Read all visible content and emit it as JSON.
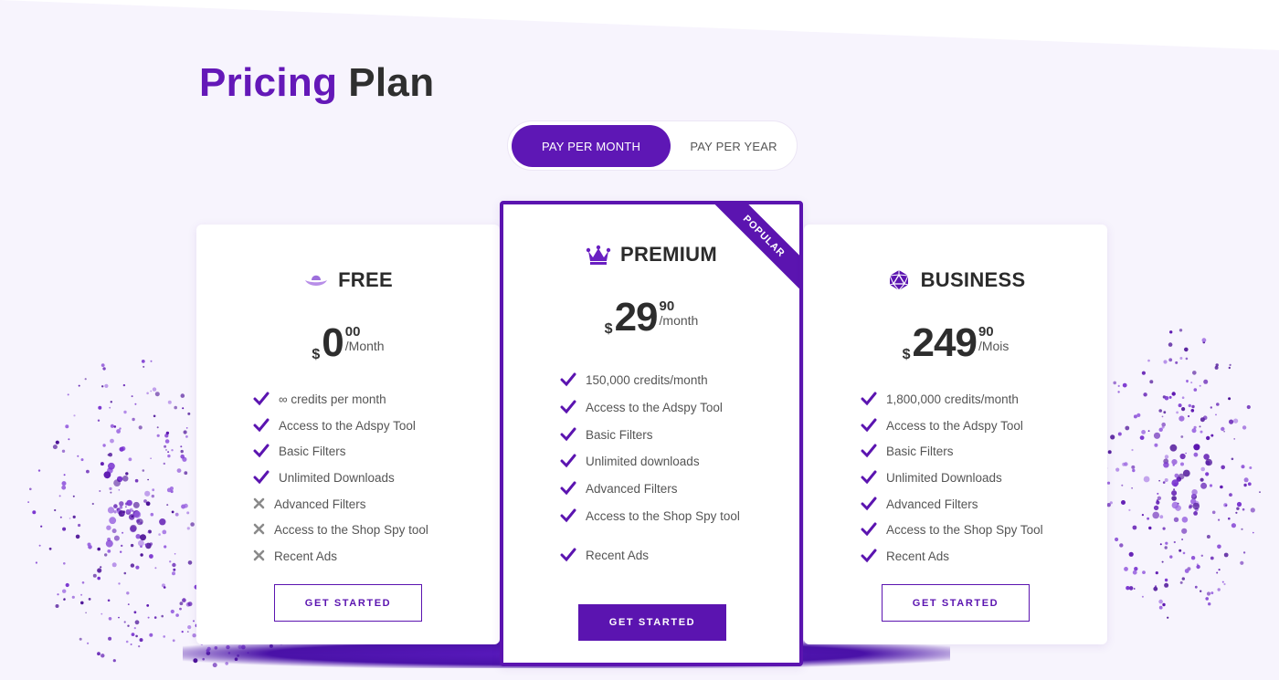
{
  "title": {
    "accent": "Pricing",
    "rest": "Plan"
  },
  "billing_toggle": {
    "monthly": "PAY PER MONTH",
    "yearly": "PAY PER YEAR",
    "selected": "monthly"
  },
  "colors": {
    "accent": "#5b14b0",
    "title_accent": "#6418b8",
    "check": "#5b14b0",
    "cross": "#8a8a8a"
  },
  "plans": [
    {
      "name": "FREE",
      "icon": "hat-icon",
      "currency": "$",
      "amount": "0",
      "cents": "00",
      "period": "/Month",
      "features": [
        {
          "label": "∞ credits per month",
          "included": true
        },
        {
          "label": "Access to the Adspy Tool",
          "included": true
        },
        {
          "label": "Basic Filters",
          "included": true
        },
        {
          "label": "Unlimited Downloads",
          "included": true
        },
        {
          "label": "Advanced Filters",
          "included": false
        },
        {
          "label": "Access to the Shop Spy tool",
          "included": false
        },
        {
          "label": "Recent Ads",
          "included": false
        }
      ],
      "cta": "GET STARTED"
    },
    {
      "name": "PREMIUM",
      "icon": "crown-icon",
      "badge": "POPULAR",
      "currency": "$",
      "amount": "29",
      "cents": "90",
      "period": "/month",
      "features": [
        {
          "label": "150,000 credits/month",
          "included": true
        },
        {
          "label": "Access to the Adspy Tool",
          "included": true
        },
        {
          "label": "Basic Filters",
          "included": true
        },
        {
          "label": "Unlimited downloads",
          "included": true
        },
        {
          "label": "Advanced Filters",
          "included": true
        },
        {
          "label": "Access to the Shop Spy tool",
          "included": true
        },
        {
          "label": "Recent Ads",
          "included": true
        }
      ],
      "cta": "GET STARTED"
    },
    {
      "name": "BUSINESS",
      "icon": "d20-dice-icon",
      "currency": "$",
      "amount": "249",
      "cents": "90",
      "period": "/Mois",
      "features": [
        {
          "label": "1,800,000 credits/month",
          "included": true
        },
        {
          "label": "Access to the Adspy Tool",
          "included": true
        },
        {
          "label": "Basic Filters",
          "included": true
        },
        {
          "label": "Unlimited Downloads",
          "included": true
        },
        {
          "label": "Advanced Filters",
          "included": true
        },
        {
          "label": "Access to the Shop Spy Tool",
          "included": true
        },
        {
          "label": "Recent Ads",
          "included": true
        }
      ],
      "cta": "GET STARTED"
    }
  ]
}
